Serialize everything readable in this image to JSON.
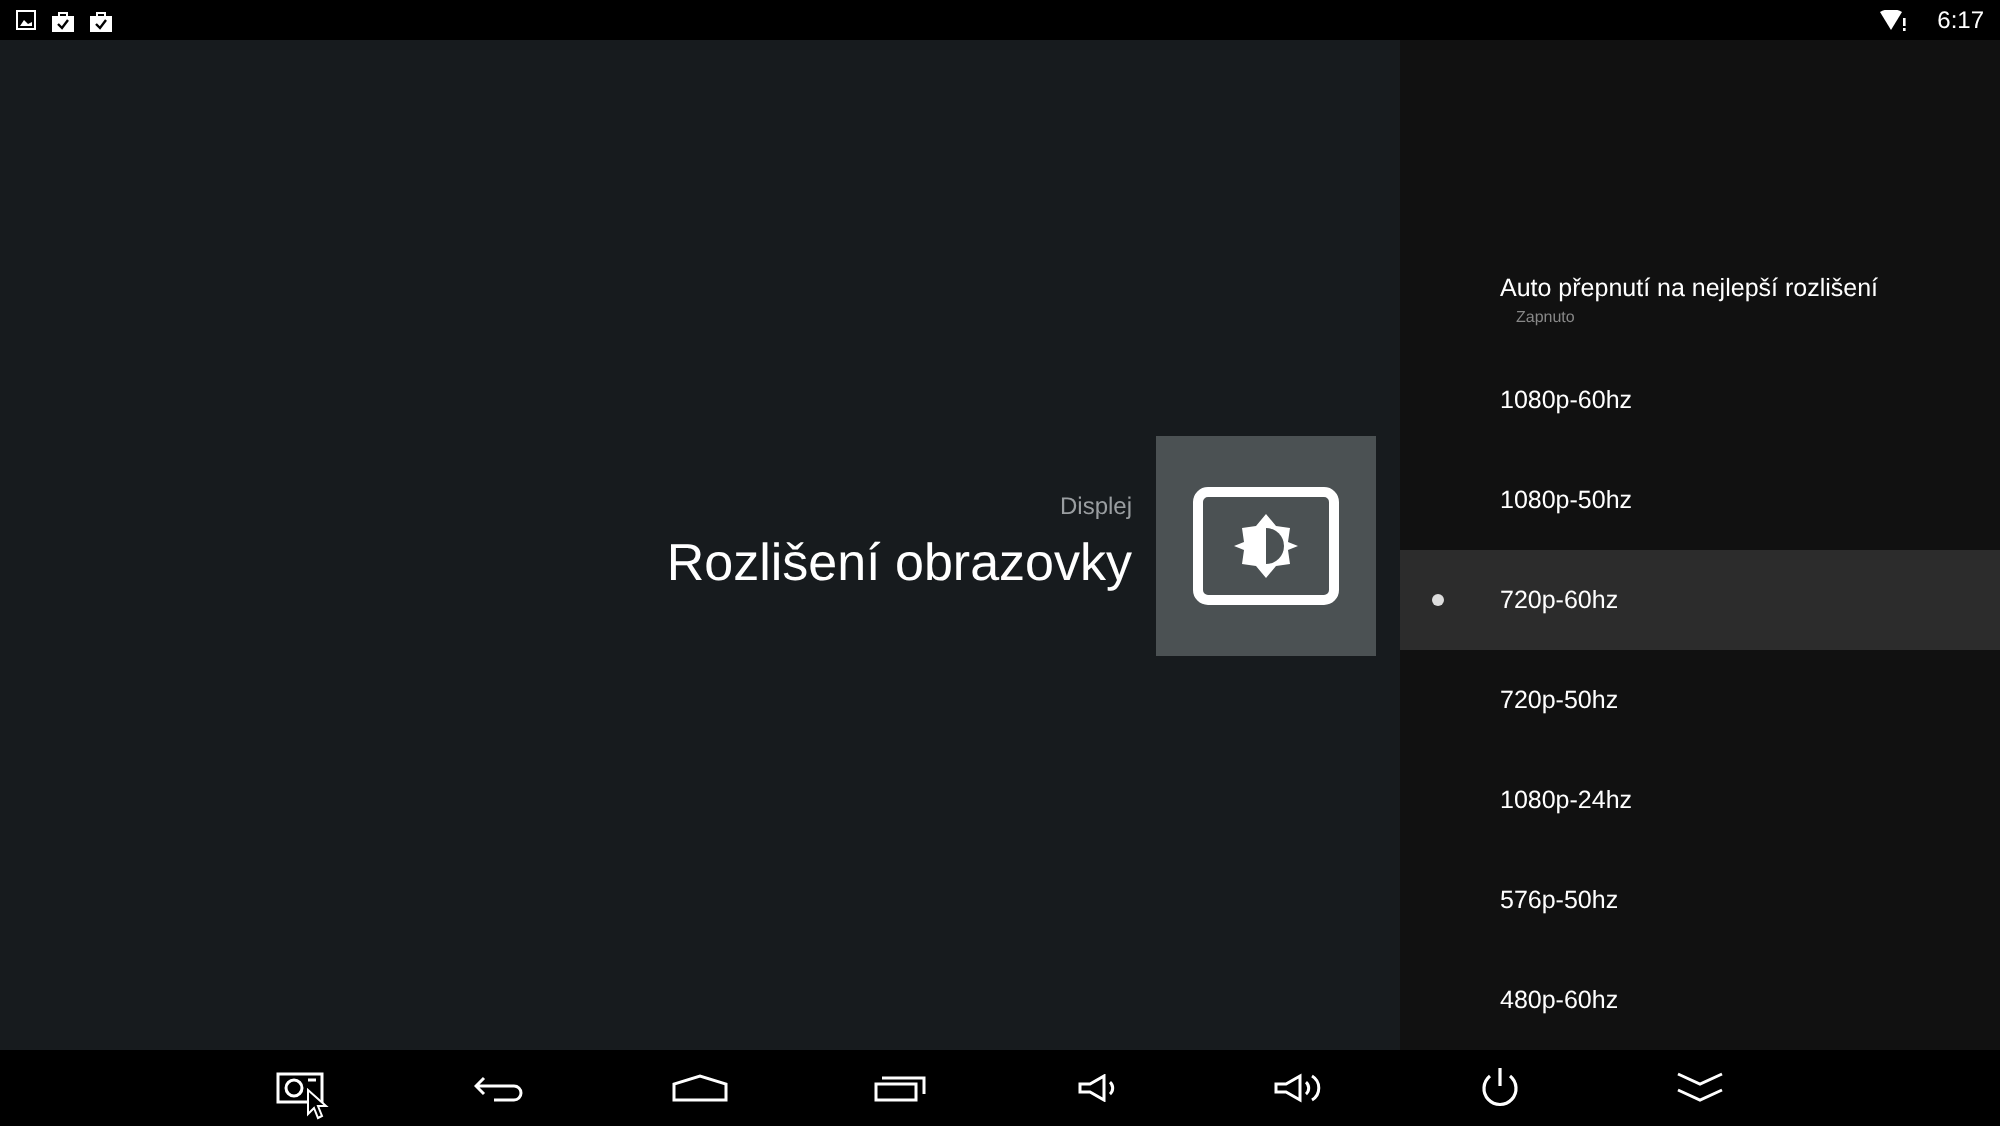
{
  "status_bar": {
    "time": "6:17"
  },
  "header": {
    "category": "Displej",
    "title": "Rozlišení obrazovky"
  },
  "options": [
    {
      "kind": "setting",
      "label": "Auto přepnutí na nejlepší rozlišení",
      "value": "Zapnuto"
    },
    {
      "kind": "radio",
      "label": "1080p-60hz",
      "selected": false
    },
    {
      "kind": "radio",
      "label": "1080p-50hz",
      "selected": false
    },
    {
      "kind": "radio",
      "label": "720p-60hz",
      "selected": true
    },
    {
      "kind": "radio",
      "label": "720p-50hz",
      "selected": false
    },
    {
      "kind": "radio",
      "label": "1080p-24hz",
      "selected": false
    },
    {
      "kind": "radio",
      "label": "576p-50hz",
      "selected": false
    },
    {
      "kind": "radio",
      "label": "480p-60hz",
      "selected": false
    }
  ]
}
